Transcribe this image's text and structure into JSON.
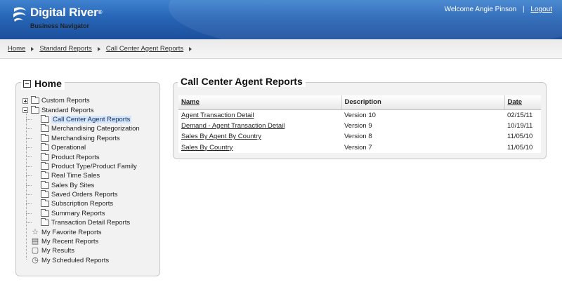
{
  "brand": {
    "name": "Digital River",
    "trademark": "®",
    "subtitle": "Business Navigator"
  },
  "user": {
    "welcome": "Welcome Angie Pinson",
    "separator": "|",
    "logout": "Logout"
  },
  "breadcrumb": [
    "Home",
    "Standard Reports",
    "Call Center Agent Reports"
  ],
  "left_panel": {
    "title": "Home",
    "tree": {
      "custom_reports": "Custom Reports",
      "standard_reports": "Standard Reports",
      "standard_children": [
        "Call Center Agent Reports",
        "Merchandising Categorization",
        "Merchandising Reports",
        "Operational",
        "Product Reports",
        "Product Type/Product Family",
        "Real Time Sales",
        "Sales By Sites",
        "Saved Orders Reports",
        "Subscription Reports",
        "Summary Reports",
        "Transaction Detail Reports"
      ],
      "favorites": "My Favorite Reports",
      "recent": "My Recent Reports",
      "results": "My Results",
      "scheduled": "My Scheduled Reports"
    }
  },
  "main": {
    "title": "Call Center Agent Reports",
    "columns": {
      "name": "Name",
      "description": "Description",
      "date": "Date"
    },
    "rows": [
      {
        "name": "Agent Transaction Detail",
        "description": "Version 10",
        "date": "02/15/11"
      },
      {
        "name": "Demand - Agent Transaction Detail",
        "description": "Version 9",
        "date": "10/19/11"
      },
      {
        "name": "Sales By Agent By Country",
        "description": "Version 8",
        "date": "11/05/10"
      },
      {
        "name": "Sales By Country",
        "description": "Version 7",
        "date": "11/05/10"
      }
    ]
  },
  "colors": {
    "header_blue": "#2765b6",
    "selected_row": "#d6e6f8"
  }
}
